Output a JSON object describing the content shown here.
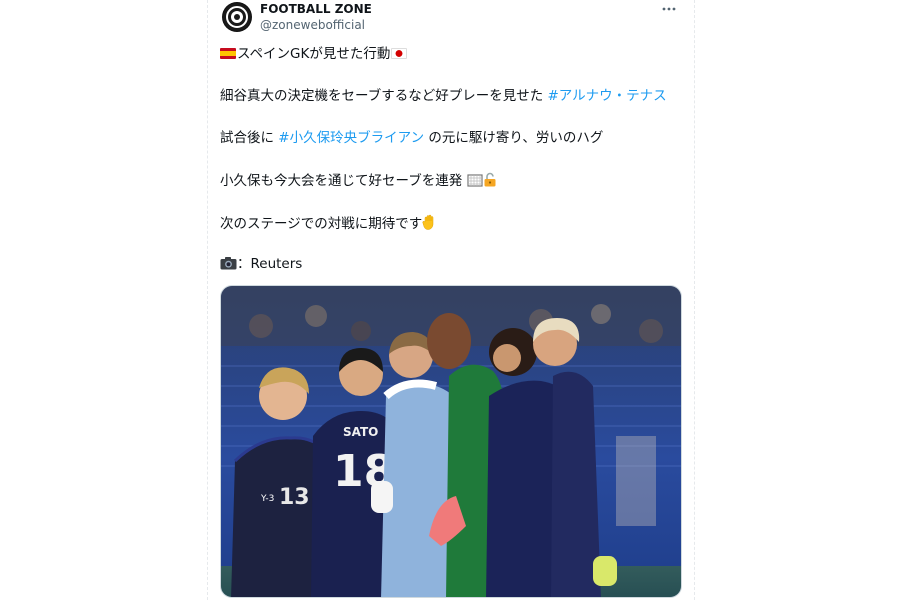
{
  "account": {
    "name": "FOOTBALL ZONE",
    "handle": "@zonewebofficial"
  },
  "icons": {
    "more": "more-dots-icon",
    "flag_spain": "spain-flag-icon",
    "flag_japan": "japan-flag-icon",
    "goal": "goal-net-icon",
    "lock": "unlocked-lock-icon",
    "hand": "raised-hand-icon",
    "camera": "camera-icon"
  },
  "tweet": {
    "line1": "スペインGKが見せた行動",
    "line2_text": "細谷真大の決定機をセーブするなど好プレーを見せた ",
    "line2_tag": "#アルナウ・テナス",
    "line3_pre": "試合後に ",
    "line3_tag": "#小久保玲央ブライアン",
    "line3_post": " の元に駆け寄り、労いのハグ",
    "line4": "小久保も今大会を通じて好セーブを連発",
    "line5": "次のステージでの対戦に期待です",
    "line6": "：Reuters"
  },
  "photo": {
    "jersey_name": "SATO",
    "jersey_number_center": "18",
    "jersey_number_left": "13",
    "brand": "Y-3"
  },
  "colors": {
    "hashtag": "#1d9bf0",
    "text": "#0f1419",
    "muted": "#536471"
  }
}
